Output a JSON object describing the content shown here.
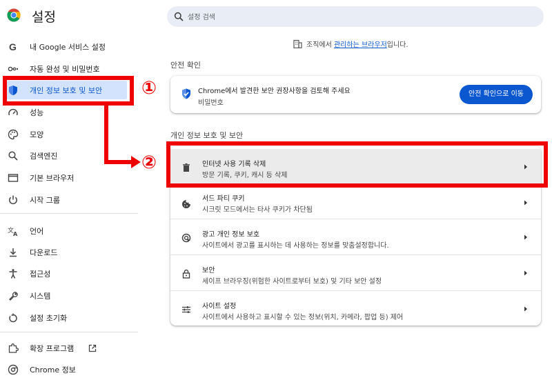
{
  "app": {
    "title": "설정"
  },
  "search": {
    "placeholder": "설정 검색"
  },
  "colors": {
    "accent": "#0b57d0",
    "active_bg": "#d3e3fd",
    "annotation_red": "#ee0000"
  },
  "sidebar": {
    "items": [
      {
        "label": "내 Google 서비스 설정",
        "icon": "google-g-icon"
      },
      {
        "label": "자동 완성 및 비밀번호",
        "icon": "key-icon"
      },
      {
        "label": "개인 정보 보호 및 보안",
        "icon": "shield-icon",
        "active": true
      },
      {
        "label": "성능",
        "icon": "speedometer-icon"
      },
      {
        "label": "모양",
        "icon": "palette-icon"
      },
      {
        "label": "검색엔진",
        "icon": "search-icon"
      },
      {
        "label": "기본 브라우저",
        "icon": "browser-window-icon"
      },
      {
        "label": "시작 그룹",
        "icon": "power-icon"
      },
      {
        "label": "언어",
        "icon": "translate-icon"
      },
      {
        "label": "다운로드",
        "icon": "download-icon"
      },
      {
        "label": "접근성",
        "icon": "accessibility-icon"
      },
      {
        "label": "시스템",
        "icon": "wrench-icon"
      },
      {
        "label": "설정 초기화",
        "icon": "restore-icon"
      },
      {
        "label": "확장 프로그램",
        "icon": "puzzle-icon"
      },
      {
        "label": "Chrome 정보",
        "icon": "chrome-icon"
      }
    ]
  },
  "managed_notice": {
    "prefix": "조직에서 ",
    "link": "관리하는 브라우저",
    "suffix": "입니다."
  },
  "safety_check": {
    "section_title": "안전 확인",
    "title": "Chrome에서 발견한 보안 권장사항을 검토해 주세요",
    "subtitle": "비밀번호",
    "button": "안전 확인으로 이동"
  },
  "privacy": {
    "section_title": "개인 정보 보호 및 보안",
    "rows": [
      {
        "title": "인터넷 사용 기록 삭제",
        "subtitle": "방문 기록, 쿠키, 캐시 등 삭제",
        "icon": "trash-icon"
      },
      {
        "title": "서드 파티 쿠키",
        "subtitle": "시크릿 모드에서는 타사 쿠키가 차단됨",
        "icon": "cookie-icon"
      },
      {
        "title": "광고 개인 정보 보호",
        "subtitle": "사이트에서 광고를 표시하는 데 사용하는 정보를 맞춤설정합니다.",
        "icon": "ad-privacy-icon"
      },
      {
        "title": "보안",
        "subtitle": "세이프 브라우징(위험한 사이트로부터 보호) 및 기타 보안 설정",
        "icon": "lock-icon"
      },
      {
        "title": "사이트 설정",
        "subtitle": "사이트에서 사용하고 표시할 수 있는 정보(위치, 카메라, 팝업 등) 제어",
        "icon": "sliders-icon"
      }
    ]
  },
  "annotations": {
    "step1": "①",
    "step2": "②"
  }
}
